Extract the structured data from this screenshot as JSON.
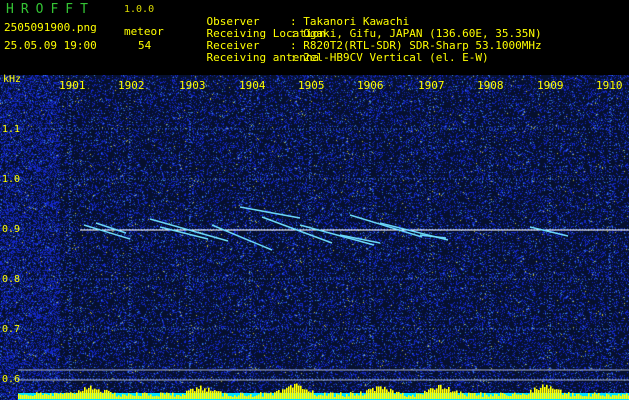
{
  "header": {
    "app_name": "HROFFT",
    "version": "1.0.0",
    "filename": "2505091900.png",
    "datetime": "25.05.09 19:00",
    "meteor_label": "meteor",
    "meteor_count": "54",
    "info": [
      {
        "label": "Observer",
        "value": ": Takanori Kawachi"
      },
      {
        "label": "Receiving Location",
        "value": ": Ogaki, Gifu, JAPAN (136.60E, 35.35N)"
      },
      {
        "label": "Receiver",
        "value": ": R820T2(RTL-SDR) SDR-Sharp 53.1000MHz"
      },
      {
        "label": "Receiving antenna",
        "value": ": 2el-HB9CV Vertical (el. E-W)"
      }
    ]
  },
  "spectrogram": {
    "unit_label": "kHz",
    "y_ticks": [
      "1.1",
      "1.0",
      "0.9",
      "0.8",
      "0.7",
      "0.6"
    ],
    "x_ticks": [
      "1901",
      "1902",
      "1903",
      "1904",
      "1905",
      "1906",
      "1907",
      "1908",
      "1909",
      "1910"
    ],
    "colors": {
      "header_text": "#ffff00",
      "app_name": "#34c434",
      "background": "#06102e",
      "grid": "#3a6bd0",
      "carrier": "#ffffff",
      "signal_bars": "#ffff00",
      "baseline": "#00e0ff"
    }
  }
}
